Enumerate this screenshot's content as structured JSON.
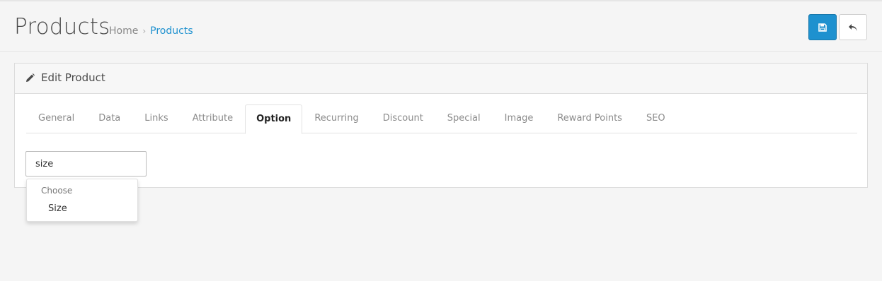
{
  "header": {
    "title": "Products",
    "breadcrumb": [
      {
        "label": "Home"
      },
      {
        "label": "Products"
      }
    ],
    "breadcrumb_separator": "›",
    "buttons": {
      "save_icon": "save-icon",
      "back_icon": "reply-icon"
    }
  },
  "panel": {
    "title": "Edit Product",
    "title_icon": "pencil-icon"
  },
  "tabs": [
    {
      "label": "General"
    },
    {
      "label": "Data"
    },
    {
      "label": "Links"
    },
    {
      "label": "Attribute"
    },
    {
      "label": "Option",
      "active": true
    },
    {
      "label": "Recurring"
    },
    {
      "label": "Discount"
    },
    {
      "label": "Special"
    },
    {
      "label": "Image"
    },
    {
      "label": "Reward Points"
    },
    {
      "label": "SEO"
    }
  ],
  "option_search": {
    "value": "size"
  },
  "dropdown": {
    "group_header": "Choose",
    "items": [
      {
        "label": "Size"
      }
    ]
  },
  "colors": {
    "accent": "#1e91cf",
    "background": "#f5f5f5"
  }
}
